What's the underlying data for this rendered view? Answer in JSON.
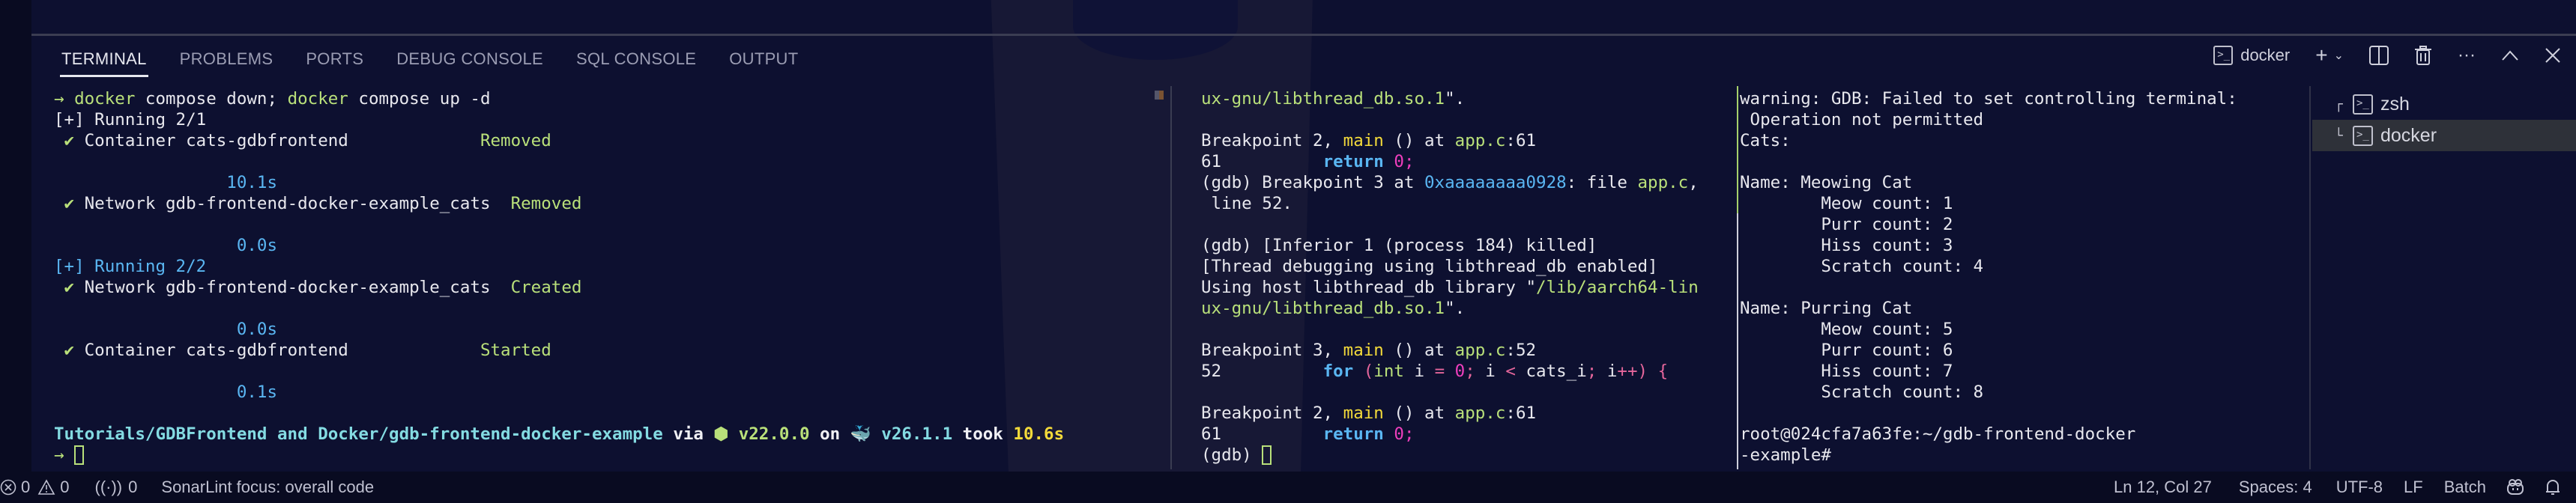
{
  "panel": {
    "tabs": [
      {
        "label": "TERMINAL",
        "active": true
      },
      {
        "label": "PROBLEMS",
        "active": false
      },
      {
        "label": "PORTS",
        "active": false
      },
      {
        "label": "DEBUG CONSOLE",
        "active": false
      },
      {
        "label": "SQL CONSOLE",
        "active": false
      },
      {
        "label": "OUTPUT",
        "active": false
      }
    ],
    "toolbar": {
      "active_terminal": "docker",
      "new_terminal_icon": "plus-icon",
      "dropdown_icon": "chevron-down-icon",
      "split_icon": "split-terminal-icon",
      "kill_icon": "trash-icon",
      "more_icon": "ellipsis-icon",
      "maximize_icon": "chevron-up-icon",
      "close_icon": "close-icon"
    }
  },
  "terminal_left": {
    "prompt_arrow": "→",
    "cmd_docker1": "docker",
    "cmd_rest1": " compose down; ",
    "cmd_docker2": "docker",
    "cmd_rest2": " compose up -d",
    "running1": "[+] Running 2/1",
    "check": "✔",
    "rows": [
      {
        "name": "Container cats-gdbfrontend             ",
        "status": "Removed",
        "time": "10.1s"
      },
      {
        "name": "Network gdb-frontend-docker-example_cats  ",
        "status": "Removed",
        "time": "0.0s"
      }
    ],
    "running2": "[+] Running 2/2",
    "rows2": [
      {
        "name": "Network gdb-frontend-docker-example_cats  ",
        "status": "Created",
        "time": "0.0s"
      },
      {
        "name": "Container cats-gdbfrontend             ",
        "status": "Started",
        "time": "0.1s"
      }
    ],
    "path": "Tutorials/GDBFrontend and Docker/gdb-frontend-docker-example",
    "via": " via ",
    "node_icon": "⬢",
    "node_version": " v22.0.0",
    "on": " on ",
    "docker_icon": "🐳",
    "docker_version": " v26.1.1",
    "took": " took ",
    "duration": "10.6s"
  },
  "terminal_gdb": {
    "l1": "ux-gnu/libthread_db.so.1",
    "l1_end": "\".",
    "bp2": "Breakpoint 2, ",
    "main": "main",
    "at": " () at ",
    "file": "app.c",
    "line61": ":61",
    "ln61": "61          ",
    "return": "return",
    "zero": " 0",
    "semi": ";",
    "gdb_bp3a": "(gdb) Breakpoint 3 at ",
    "addr": "0xaaaaaaaa0928",
    "file_txt": ": file ",
    "file2": "app.c",
    "comma": ",",
    "line52_txt": " line 52.",
    "inferior": "(gdb) [Inferior 1 (process 184) killed]",
    "thread": "[Thread debugging using libthread_db enabled]",
    "using": "Using host libthread_db library \"",
    "lib": "/lib/aarch64-lin",
    "lib2": "ux-gnu/libthread_db.so.1",
    "lib2_end": "\".",
    "bp3": "Breakpoint 3, ",
    "line52": ":52",
    "ln52": "52          ",
    "for_kw": "for",
    "for_rest_1": " (",
    "int_kw": "int",
    "i_eq": " i ",
    "eq": "=",
    "zero2": " 0",
    "semi2": ";",
    "i_lt": " i ",
    "lt": "<",
    "cats_i": " cats_i",
    "semi3": ";",
    "ipp": " i",
    "pp": "++",
    "close": ") {",
    "gdb_prompt": "(gdb) "
  },
  "terminal_right": {
    "lines": [
      "warning: GDB: Failed to set controlling terminal:",
      " Operation not permitted",
      "Cats:",
      "",
      "Name: Meowing Cat",
      "        Meow count: 1",
      "        Purr count: 2",
      "        Hiss count: 3",
      "        Scratch count: 4",
      "",
      "Name: Purring Cat",
      "        Meow count: 5",
      "        Purr count: 6",
      "        Hiss count: 7",
      "        Scratch count: 8",
      "",
      "root@024cfa7a63fe:~/gdb-frontend-docker",
      "-example#"
    ]
  },
  "terminal_list": [
    {
      "tree": "┌",
      "label": "zsh",
      "selected": false
    },
    {
      "tree": "└",
      "label": "docker",
      "selected": true
    }
  ],
  "statusbar": {
    "errors": "0",
    "warnings": "0",
    "ports": "0",
    "sonarlint": "SonarLint focus: overall code",
    "position": "Ln 12, Col 27",
    "spaces": "Spaces: 4",
    "encoding": "UTF-8",
    "eol": "LF",
    "language": "Batch"
  },
  "colors": {
    "background": "#0d1030",
    "green": "#b9e07a",
    "blue": "#5ab6f2",
    "yellow": "#f3da3a",
    "cyan": "#84dbe2",
    "magenta": "#ef3fbd"
  }
}
